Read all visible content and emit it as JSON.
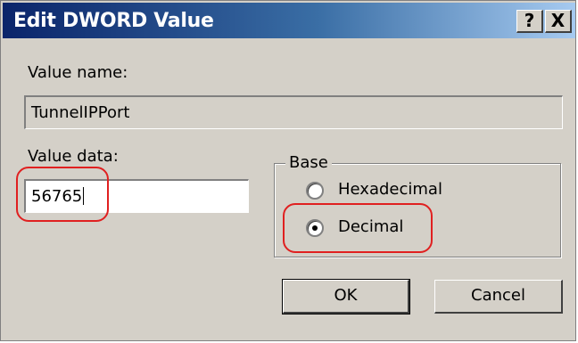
{
  "window": {
    "title": "Edit DWORD Value"
  },
  "titlebar": {
    "help_label": "?",
    "close_label": "X"
  },
  "value_name": {
    "label": "Value name:",
    "value": "TunnelIPPort"
  },
  "value_data": {
    "label": "Value data:",
    "value": "56765"
  },
  "base": {
    "legend": "Base",
    "options": [
      {
        "label": "Hexadecimal",
        "selected": false
      },
      {
        "label": "Decimal",
        "selected": true
      }
    ]
  },
  "buttons": {
    "ok_label": "OK",
    "cancel_label": "Cancel"
  },
  "annotation_color": "#e02020"
}
